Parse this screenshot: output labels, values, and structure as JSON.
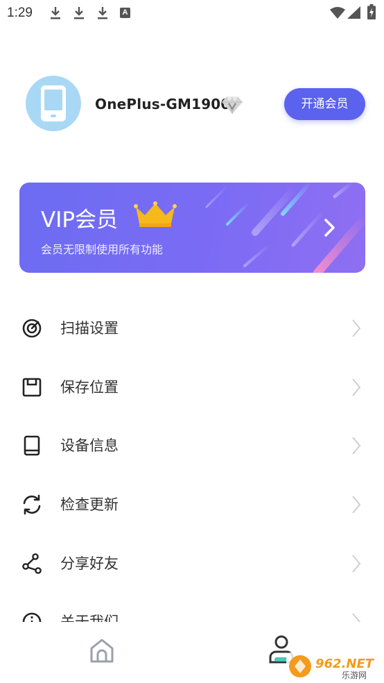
{
  "status_bar": {
    "time": "1:29",
    "notification_badge": "A"
  },
  "profile": {
    "device_name": "OnePlus-GM1900",
    "vip_button_label": "开通会员"
  },
  "vip_card": {
    "title": "VIP会员",
    "subtitle": "会员无限制使用所有功能"
  },
  "menu": [
    {
      "label": "扫描设置",
      "icon": "target-icon"
    },
    {
      "label": "保存位置",
      "icon": "floppy-disk-icon"
    },
    {
      "label": "设备信息",
      "icon": "tablet-icon"
    },
    {
      "label": "检查更新",
      "icon": "refresh-icon"
    },
    {
      "label": "分享好友",
      "icon": "share-icon"
    },
    {
      "label": "关于我们",
      "icon": "info-icon"
    }
  ],
  "bottom_nav": [
    {
      "icon": "home-icon",
      "active": false
    },
    {
      "icon": "profile-icon",
      "active": true
    }
  ],
  "watermark": {
    "text": "962.NET",
    "subtext": "乐游网"
  },
  "colors": {
    "accent": "#5b62ee",
    "vip_card_start": "#6c6cf2",
    "vip_card_end": "#8f6ff2",
    "crown": "#f6b91c"
  }
}
